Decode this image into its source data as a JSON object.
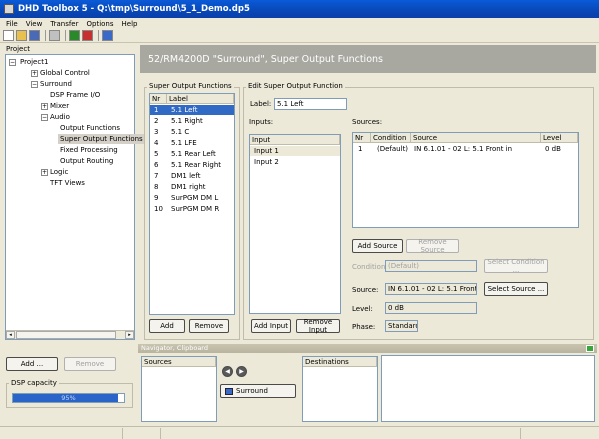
{
  "window": {
    "title": "DHD Toolbox 5 - Q:\\tmp\\Surround\\5_1_Demo.dp5"
  },
  "menu": [
    "File",
    "View",
    "Transfer",
    "Options",
    "Help"
  ],
  "project_panel": {
    "label": "Project",
    "tree": [
      {
        "label": "Project1",
        "indent": 0,
        "expander": "−"
      },
      {
        "label": "Global Control",
        "indent": 1,
        "expander": "+"
      },
      {
        "label": "Surround",
        "indent": 1,
        "expander": "−"
      },
      {
        "label": "DSP Frame I/O",
        "indent": 2,
        "expander": ""
      },
      {
        "label": "Mixer",
        "indent": 2,
        "expander": "+"
      },
      {
        "label": "Audio",
        "indent": 2,
        "expander": "−"
      },
      {
        "label": "Output Functions",
        "indent": 3,
        "expander": ""
      },
      {
        "label": "Super Output Functions",
        "indent": 3,
        "expander": "",
        "selected": true
      },
      {
        "label": "Fixed Processing",
        "indent": 3,
        "expander": ""
      },
      {
        "label": "Output Routing",
        "indent": 3,
        "expander": ""
      },
      {
        "label": "Logic",
        "indent": 2,
        "expander": "+"
      },
      {
        "label": "TFT Views",
        "indent": 2,
        "expander": ""
      }
    ],
    "add_label": "Add ...",
    "remove_label": "Remove",
    "dsp_capacity_label": "DSP capacity",
    "dsp_capacity_text": "95%",
    "dsp_capacity": 0.95
  },
  "banner": {
    "title": "52/RM4200D \"Surround\", Super Output Functions"
  },
  "sof": {
    "title": "Super Output Functions",
    "col_nr": "Nr",
    "col_label": "Label",
    "rows": [
      {
        "nr": "1",
        "label": "5.1 Left",
        "selected": true
      },
      {
        "nr": "2",
        "label": "5.1 Right"
      },
      {
        "nr": "3",
        "label": "5.1 C"
      },
      {
        "nr": "4",
        "label": "5.1 LFE"
      },
      {
        "nr": "5",
        "label": "5.1 Rear Left"
      },
      {
        "nr": "6",
        "label": "5.1 Rear Right"
      },
      {
        "nr": "7",
        "label": "DM1 left"
      },
      {
        "nr": "8",
        "label": "DM1 right"
      },
      {
        "nr": "9",
        "label": "SurPGM DM L"
      },
      {
        "nr": "10",
        "label": "SurPGM DM R"
      }
    ],
    "add_label": "Add",
    "remove_label": "Remove"
  },
  "edit": {
    "title": "Edit Super Output Function",
    "label_caption": "Label:",
    "label_value": "5.1 Left",
    "inputs_caption": "Inputs:",
    "inputs_header": "Input",
    "inputs": [
      {
        "label": "Input 1",
        "selected": true
      },
      {
        "label": "Input 2"
      }
    ],
    "add_input_label": "Add Input",
    "remove_input_label": "Remove Input",
    "sources_caption": "Sources:",
    "sources_headers": {
      "nr": "Nr",
      "condition": "Condition",
      "source": "Source",
      "level": "Level"
    },
    "sources": [
      {
        "nr": "1",
        "condition": "(Default)",
        "source": "IN 6.1.01 - 02 L: 5.1 Front in",
        "level": "0 dB"
      }
    ],
    "add_source_label": "Add Source",
    "remove_source_label": "Remove Source",
    "condition_caption": "Condition:",
    "condition_value": "(Default)",
    "select_condition_label": "Select Condition ...",
    "source_caption": "Source:",
    "source_value": "IN 6.1.01 - 02 L: 5.1 Front in",
    "select_source_label": "Select Source ...",
    "level_caption": "Level:",
    "level_value": "0 dB",
    "phase_caption": "Phase:",
    "phase_value": "Standard"
  },
  "navigator": {
    "title": "Navigator, Clipboard",
    "sources_header": "Sources",
    "destinations_header": "Destinations",
    "item_label": "Surround"
  }
}
